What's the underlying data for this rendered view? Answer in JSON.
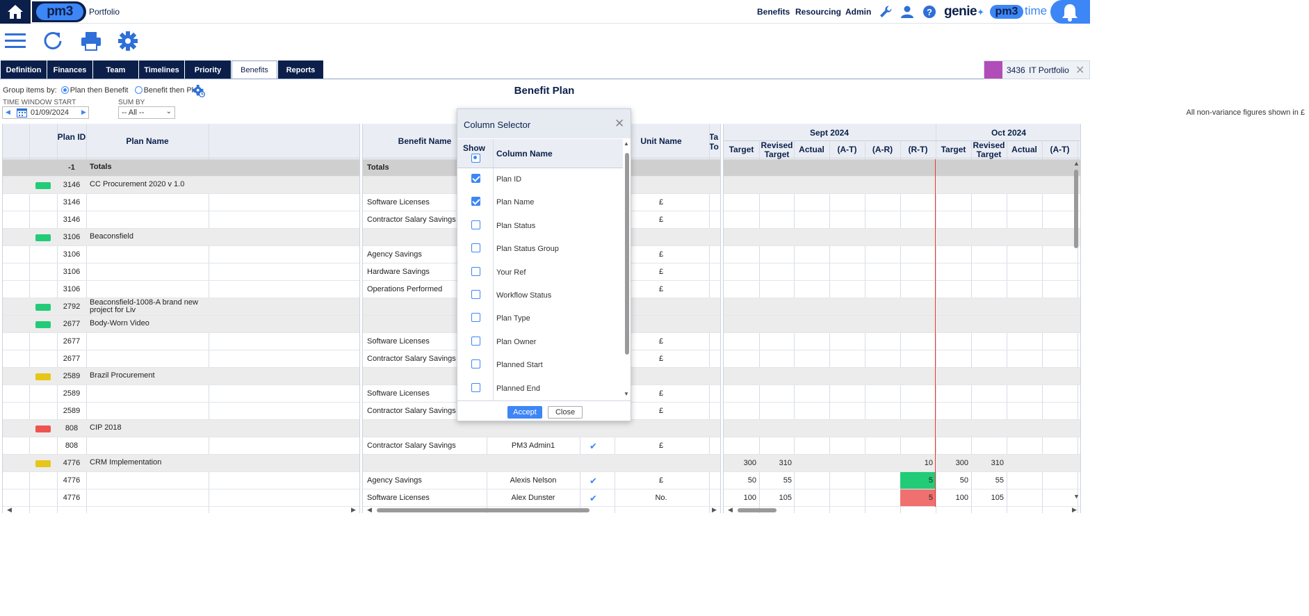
{
  "header": {
    "logo": "pm3",
    "portfolio_label": "Portfolio",
    "nav": [
      "Benefits",
      "Resourcing",
      "Admin"
    ],
    "genie": "genie",
    "pm3time_logo": "pm3",
    "pm3time_word": "time",
    "icons": [
      "home-icon",
      "wrench-icon",
      "user-icon",
      "help-icon",
      "bell-icon"
    ]
  },
  "toolbar": {
    "icons": [
      "menu-icon",
      "refresh-icon",
      "print-icon",
      "settings-icon"
    ]
  },
  "tabs": [
    "Definition",
    "Finances",
    "Team",
    "Timelines",
    "Priority Matrix",
    "Benefits",
    "Reports"
  ],
  "active_tab": "Benefits",
  "portfolio_chip": {
    "id": "3436",
    "name": "IT Portfolio",
    "color": "#b04db8"
  },
  "controls": {
    "group_label": "Group items by:",
    "group_options": [
      "Plan then Benefit",
      "Benefit then Plan"
    ],
    "group_selected": "Plan then Benefit",
    "time_window_label": "TIME WINDOW START",
    "time_window_value": "01/09/2024",
    "sum_by_label": "SUM BY",
    "sum_by_value": "-- All --",
    "note": "All non-variance figures shown in £"
  },
  "page_title": "Benefit Plan",
  "table": {
    "left_headers": [
      "Plan ID",
      "Plan Name"
    ],
    "mid_headers": [
      "Benefit Name",
      "Unit Name",
      "Ta To"
    ],
    "months": [
      "Sept 2024",
      "Oct 2024"
    ],
    "sub_headers": [
      "Target",
      "Revised Target",
      "Actual",
      "(A-T)",
      "(A-R)",
      "(R-T)"
    ],
    "sub_headers_oct": [
      "Target",
      "Revised Target",
      "Actual",
      "(A-T)"
    ],
    "rows": [
      {
        "type": "totals",
        "id": "-1",
        "plan": "Totals",
        "benefit": "Totals",
        "status": "",
        "owner": "",
        "tick": false,
        "unit": "",
        "s": [
          "",
          "",
          "",
          "",
          "",
          ""
        ],
        "o": [
          "",
          "",
          "",
          ""
        ]
      },
      {
        "type": "grp",
        "id": "3146",
        "plan": "CC Procurement 2020 v 1.0",
        "benefit": "",
        "status": "#22cc77",
        "owner": "",
        "tick": false,
        "unit": "",
        "s": [
          "",
          "",
          "",
          "",
          "",
          ""
        ],
        "o": [
          "",
          "",
          "",
          ""
        ]
      },
      {
        "type": "item",
        "id": "3146",
        "plan": "",
        "benefit": "Software Licenses",
        "status": "",
        "owner": "",
        "tick": false,
        "unit": "£",
        "s": [
          "",
          "",
          "",
          "",
          "",
          ""
        ],
        "o": [
          "",
          "",
          "",
          ""
        ]
      },
      {
        "type": "item",
        "id": "3146",
        "plan": "",
        "benefit": "Contractor Salary Savings",
        "status": "",
        "owner": "",
        "tick": false,
        "unit": "£",
        "s": [
          "",
          "",
          "",
          "",
          "",
          ""
        ],
        "o": [
          "",
          "",
          "",
          ""
        ]
      },
      {
        "type": "grp",
        "id": "3106",
        "plan": "Beaconsfield",
        "benefit": "",
        "status": "#22cc77",
        "owner": "",
        "tick": false,
        "unit": "",
        "s": [
          "",
          "",
          "",
          "",
          "",
          ""
        ],
        "o": [
          "",
          "",
          "",
          ""
        ]
      },
      {
        "type": "item",
        "id": "3106",
        "plan": "",
        "benefit": "Agency Savings",
        "status": "",
        "owner": "",
        "tick": false,
        "unit": "£",
        "s": [
          "",
          "",
          "",
          "",
          "",
          ""
        ],
        "o": [
          "",
          "",
          "",
          ""
        ]
      },
      {
        "type": "item",
        "id": "3106",
        "plan": "",
        "benefit": "Hardware Savings",
        "status": "",
        "owner": "",
        "tick": false,
        "unit": "£",
        "s": [
          "",
          "",
          "",
          "",
          "",
          ""
        ],
        "o": [
          "",
          "",
          "",
          ""
        ]
      },
      {
        "type": "item",
        "id": "3106",
        "plan": "",
        "benefit": "Operations Performed",
        "status": "",
        "owner": "",
        "tick": false,
        "unit": "£",
        "s": [
          "",
          "",
          "",
          "",
          "",
          ""
        ],
        "o": [
          "",
          "",
          "",
          ""
        ]
      },
      {
        "type": "grp",
        "id": "2792",
        "plan": "Beaconsfield-1008-A brand new project for Liv",
        "benefit": "",
        "status": "#22cc77",
        "owner": "",
        "tick": false,
        "unit": "",
        "s": [
          "",
          "",
          "",
          "",
          "",
          ""
        ],
        "o": [
          "",
          "",
          "",
          ""
        ]
      },
      {
        "type": "grp",
        "id": "2677",
        "plan": "Body-Worn Video",
        "benefit": "",
        "status": "#22cc77",
        "owner": "",
        "tick": false,
        "unit": "",
        "s": [
          "",
          "",
          "",
          "",
          "",
          ""
        ],
        "o": [
          "",
          "",
          "",
          ""
        ]
      },
      {
        "type": "item",
        "id": "2677",
        "plan": "",
        "benefit": "Software Licenses",
        "status": "",
        "owner": "",
        "tick": false,
        "unit": "£",
        "s": [
          "",
          "",
          "",
          "",
          "",
          ""
        ],
        "o": [
          "",
          "",
          "",
          ""
        ]
      },
      {
        "type": "item",
        "id": "2677",
        "plan": "",
        "benefit": "Contractor Salary Savings",
        "status": "",
        "owner": "",
        "tick": false,
        "unit": "£",
        "s": [
          "",
          "",
          "",
          "",
          "",
          ""
        ],
        "o": [
          "",
          "",
          "",
          ""
        ]
      },
      {
        "type": "grp",
        "id": "2589",
        "plan": "Brazil Procurement",
        "benefit": "",
        "status": "#e6c619",
        "owner": "",
        "tick": false,
        "unit": "",
        "s": [
          "",
          "",
          "",
          "",
          "",
          ""
        ],
        "o": [
          "",
          "",
          "",
          ""
        ]
      },
      {
        "type": "item",
        "id": "2589",
        "plan": "",
        "benefit": "Software Licenses",
        "status": "",
        "owner": "",
        "tick": false,
        "unit": "£",
        "s": [
          "",
          "",
          "",
          "",
          "",
          ""
        ],
        "o": [
          "",
          "",
          "",
          ""
        ]
      },
      {
        "type": "item",
        "id": "2589",
        "plan": "",
        "benefit": "Contractor Salary Savings",
        "status": "",
        "owner": "",
        "tick": false,
        "unit": "£",
        "s": [
          "",
          "",
          "",
          "",
          "",
          ""
        ],
        "o": [
          "",
          "",
          "",
          ""
        ]
      },
      {
        "type": "grp",
        "id": "808",
        "plan": "CIP 2018",
        "benefit": "",
        "status": "#ef5350",
        "owner": "",
        "tick": false,
        "unit": "",
        "s": [
          "",
          "",
          "",
          "",
          "",
          ""
        ],
        "o": [
          "",
          "",
          "",
          ""
        ]
      },
      {
        "type": "item",
        "id": "808",
        "plan": "",
        "benefit": "Contractor Salary Savings",
        "status": "",
        "owner": "PM3 Admin1",
        "tick": true,
        "unit": "£",
        "s": [
          "",
          "",
          "",
          "",
          "",
          ""
        ],
        "o": [
          "",
          "",
          "",
          ""
        ]
      },
      {
        "type": "grp",
        "id": "4776",
        "plan": "CRM Implementation",
        "benefit": "",
        "status": "#e6c619",
        "owner": "",
        "tick": false,
        "unit": "",
        "s": [
          "300",
          "310",
          "",
          "",
          "",
          "10"
        ],
        "o": [
          "300",
          "310",
          "",
          ""
        ]
      },
      {
        "type": "item",
        "id": "4776",
        "plan": "",
        "benefit": "Agency Savings",
        "status": "",
        "owner": "Alexis Nelson",
        "tick": true,
        "unit": "£",
        "s": [
          "50",
          "55",
          "",
          "",
          "",
          "5"
        ],
        "o": [
          "50",
          "55",
          "",
          ""
        ],
        "rt_color": "#22cc77"
      },
      {
        "type": "item",
        "id": "4776",
        "plan": "",
        "benefit": "Software Licenses",
        "status": "",
        "owner": "Alex Dunster",
        "tick": true,
        "unit": "No.",
        "s": [
          "100",
          "105",
          "",
          "",
          "",
          "5"
        ],
        "o": [
          "100",
          "105",
          "",
          ""
        ],
        "rt_color": "#f07070"
      }
    ]
  },
  "dialog": {
    "title": "Column Selector",
    "show_label": "Show",
    "column_name_label": "Column Name",
    "items": [
      {
        "label": "Plan ID",
        "checked": true
      },
      {
        "label": "Plan Name",
        "checked": true
      },
      {
        "label": "Plan Status",
        "checked": false
      },
      {
        "label": "Plan Status Group",
        "checked": false
      },
      {
        "label": "Your Ref",
        "checked": false
      },
      {
        "label": "Workflow Status",
        "checked": false
      },
      {
        "label": "Plan Type",
        "checked": false
      },
      {
        "label": "Plan Owner",
        "checked": false
      },
      {
        "label": "Planned Start",
        "checked": false
      },
      {
        "label": "Planned End",
        "checked": false
      }
    ],
    "accept": "Accept",
    "close": "Close"
  }
}
